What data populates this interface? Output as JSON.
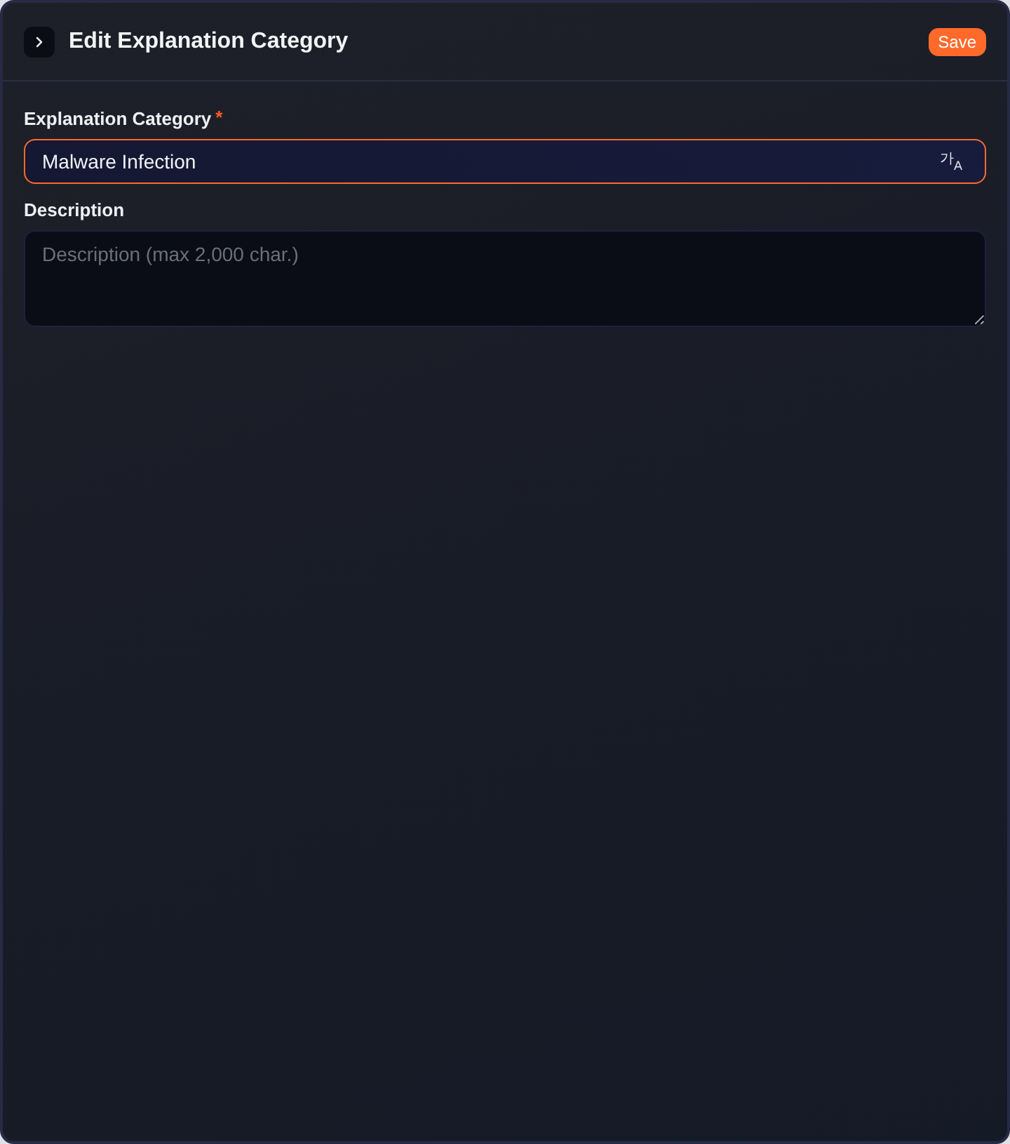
{
  "panel": {
    "title": "Edit Explanation Category",
    "save_button": "Save"
  },
  "fields": [
    {
      "kind": "input",
      "label": "Explanation Category",
      "required_mark": "*",
      "value": "Malware Infection",
      "focused": true,
      "translate_toggle": {
        "script": "가",
        "latin": "A"
      }
    },
    {
      "kind": "textarea",
      "label": "Description",
      "placeholder": "Description (max 2,000 char.)",
      "focused": false
    }
  ]
}
